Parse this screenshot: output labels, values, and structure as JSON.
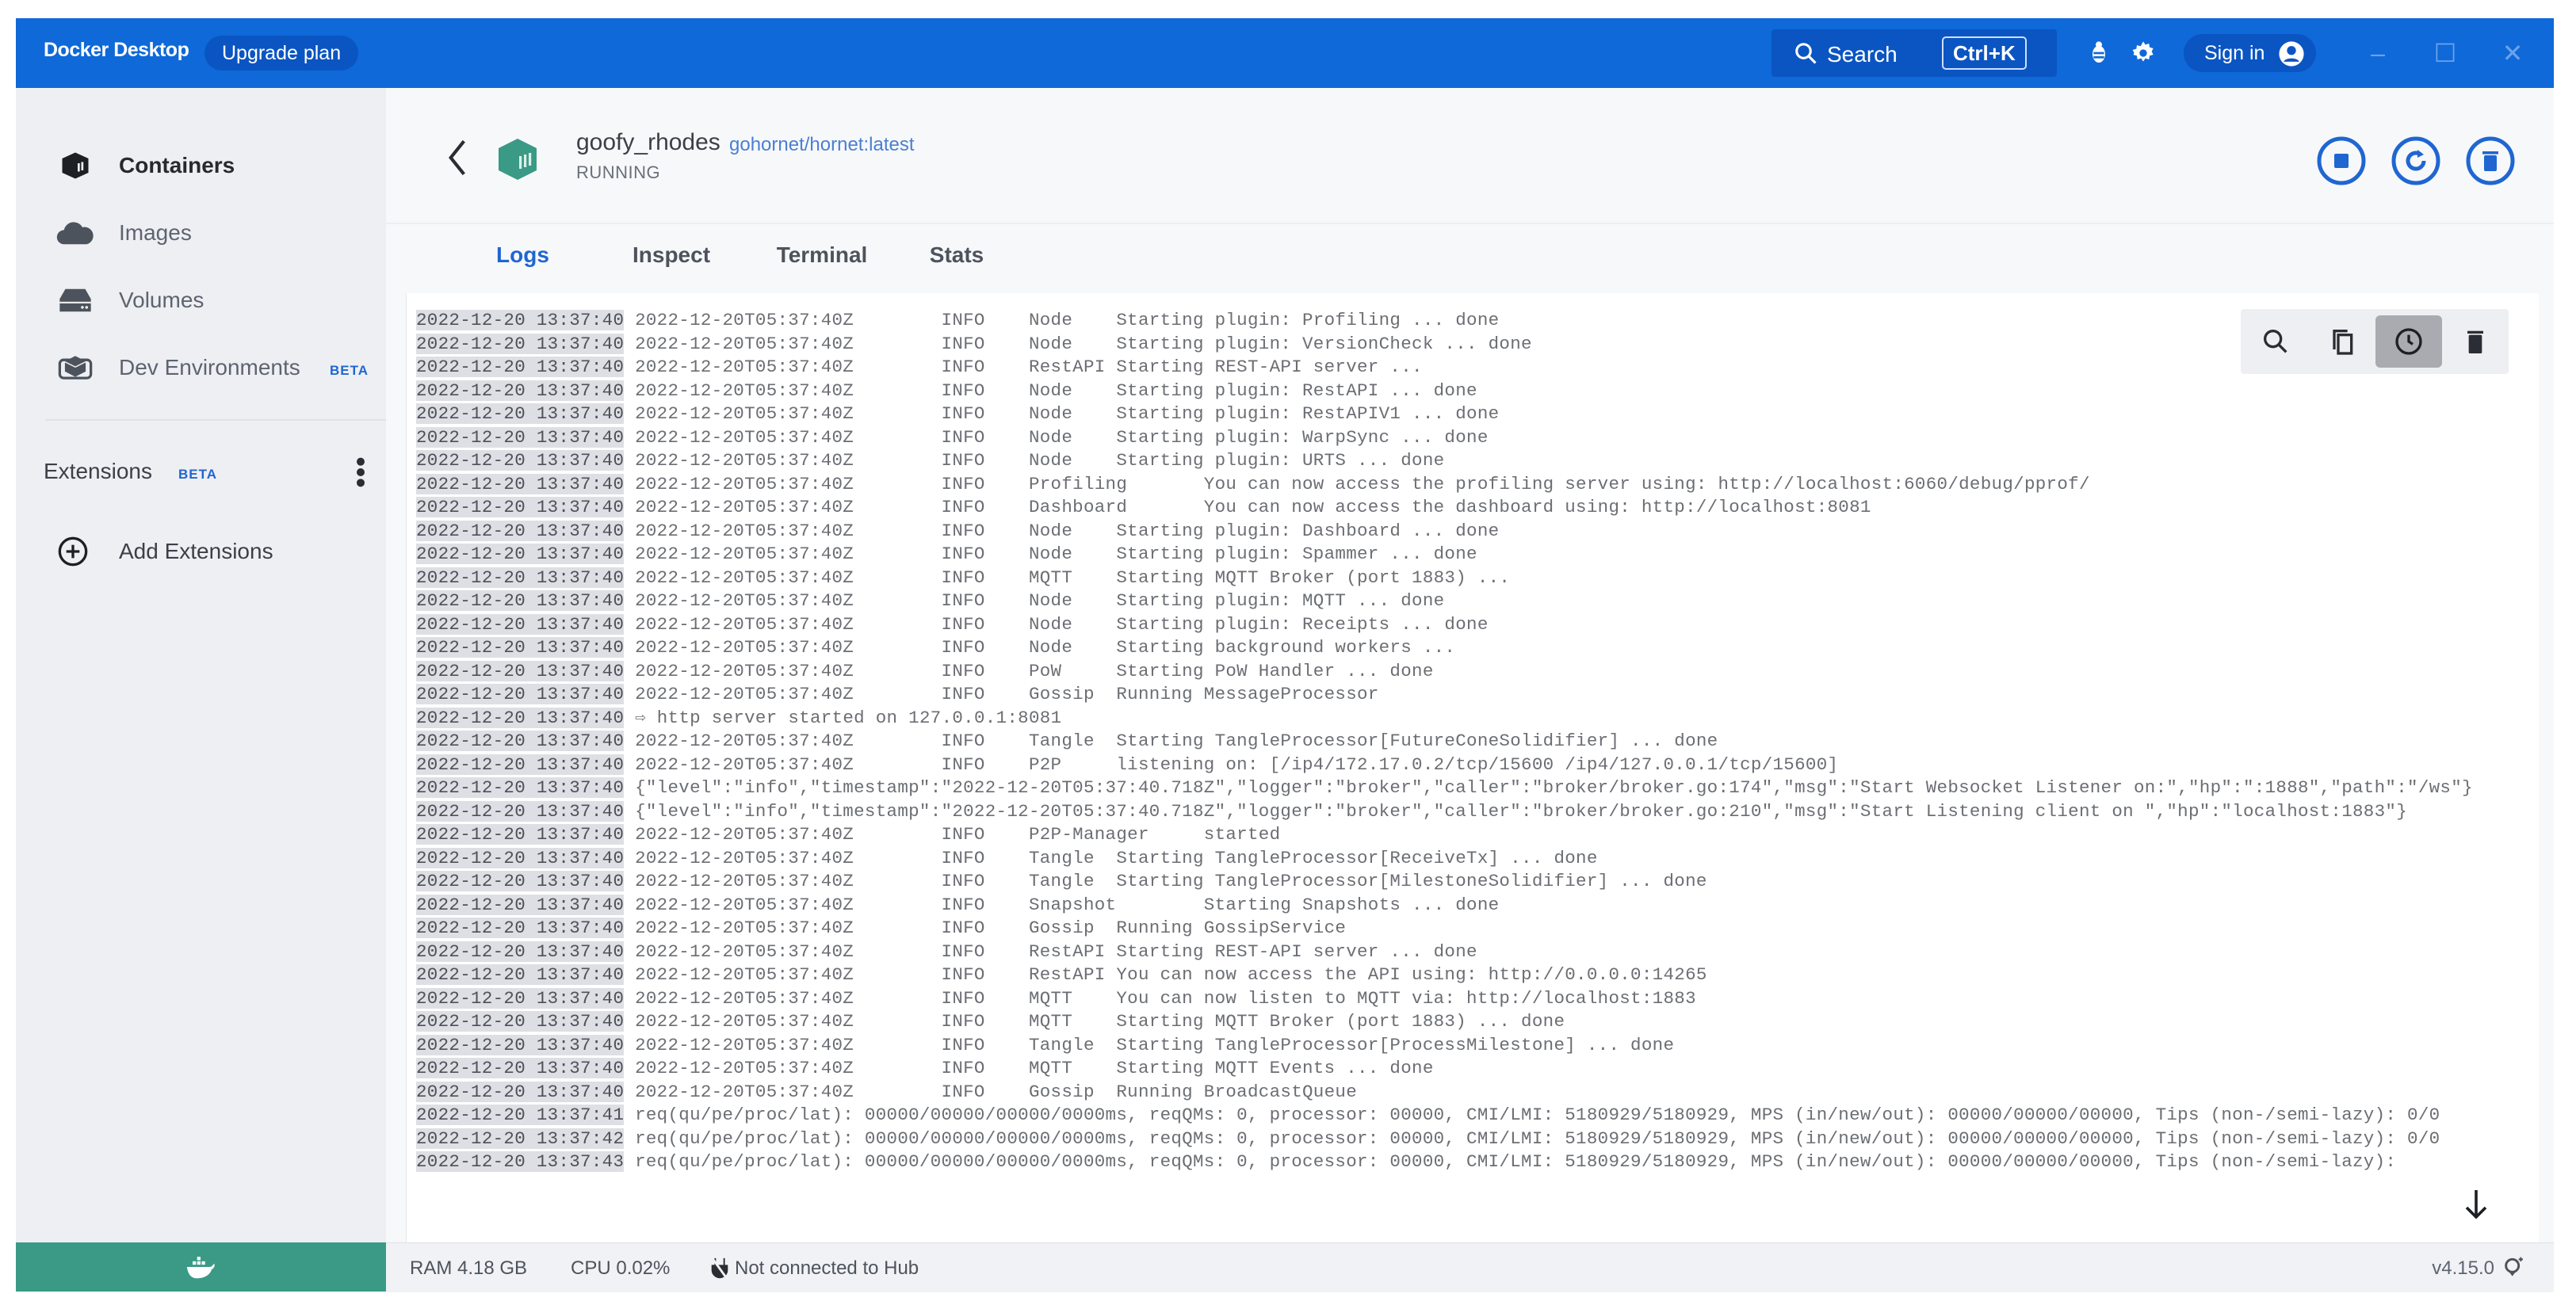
{
  "titlebar": {
    "app_name": "Docker Desktop",
    "upgrade_label": "Upgrade plan",
    "search_label": "Search",
    "search_shortcut": "Ctrl+K",
    "signin_label": "Sign in",
    "minimize": "–",
    "maximize": "☐",
    "close": "✕"
  },
  "sidebar": {
    "items": [
      {
        "label": "Containers",
        "icon": "container-icon",
        "active": true
      },
      {
        "label": "Images",
        "icon": "cloud-icon"
      },
      {
        "label": "Volumes",
        "icon": "volume-icon"
      },
      {
        "label": "Dev Environments",
        "icon": "dev-env-icon",
        "badge": "BETA"
      }
    ],
    "extensions_label": "Extensions",
    "extensions_badge": "BETA",
    "add_extensions_label": "Add Extensions"
  },
  "container": {
    "name": "goofy_rhodes",
    "image": "gohornet/hornet:latest",
    "status": "RUNNING"
  },
  "tabs": [
    {
      "label": "Logs",
      "active": true
    },
    {
      "label": "Inspect"
    },
    {
      "label": "Terminal"
    },
    {
      "label": "Stats"
    }
  ],
  "log_toolbar": [
    "search-icon",
    "copy-icon",
    "timestamps-icon",
    "clear-icon"
  ],
  "logs": [
    {
      "ts": "2022-12-20 13:37:40",
      "text": "2022-12-20T05:37:40Z        INFO    Node    Starting plugin: Profiling ... done"
    },
    {
      "ts": "2022-12-20 13:37:40",
      "text": "2022-12-20T05:37:40Z        INFO    Node    Starting plugin: VersionCheck ... done"
    },
    {
      "ts": "2022-12-20 13:37:40",
      "text": "2022-12-20T05:37:40Z        INFO    RestAPI Starting REST-API server ..."
    },
    {
      "ts": "2022-12-20 13:37:40",
      "text": "2022-12-20T05:37:40Z        INFO    Node    Starting plugin: RestAPI ... done"
    },
    {
      "ts": "2022-12-20 13:37:40",
      "text": "2022-12-20T05:37:40Z        INFO    Node    Starting plugin: RestAPIV1 ... done"
    },
    {
      "ts": "2022-12-20 13:37:40",
      "text": "2022-12-20T05:37:40Z        INFO    Node    Starting plugin: WarpSync ... done"
    },
    {
      "ts": "2022-12-20 13:37:40",
      "text": "2022-12-20T05:37:40Z        INFO    Node    Starting plugin: URTS ... done"
    },
    {
      "ts": "2022-12-20 13:37:40",
      "text": "2022-12-20T05:37:40Z        INFO    Profiling       You can now access the profiling server using: http://localhost:6060/debug/pprof/"
    },
    {
      "ts": "2022-12-20 13:37:40",
      "text": "2022-12-20T05:37:40Z        INFO    Dashboard       You can now access the dashboard using: http://localhost:8081"
    },
    {
      "ts": "2022-12-20 13:37:40",
      "text": "2022-12-20T05:37:40Z        INFO    Node    Starting plugin: Dashboard ... done"
    },
    {
      "ts": "2022-12-20 13:37:40",
      "text": "2022-12-20T05:37:40Z        INFO    Node    Starting plugin: Spammer ... done"
    },
    {
      "ts": "2022-12-20 13:37:40",
      "text": "2022-12-20T05:37:40Z        INFO    MQTT    Starting MQTT Broker (port 1883) ..."
    },
    {
      "ts": "2022-12-20 13:37:40",
      "text": "2022-12-20T05:37:40Z        INFO    Node    Starting plugin: MQTT ... done"
    },
    {
      "ts": "2022-12-20 13:37:40",
      "text": "2022-12-20T05:37:40Z        INFO    Node    Starting plugin: Receipts ... done"
    },
    {
      "ts": "2022-12-20 13:37:40",
      "text": "2022-12-20T05:37:40Z        INFO    Node    Starting background workers ..."
    },
    {
      "ts": "2022-12-20 13:37:40",
      "text": "2022-12-20T05:37:40Z        INFO    PoW     Starting PoW Handler ... done"
    },
    {
      "ts": "2022-12-20 13:37:40",
      "text": "2022-12-20T05:37:40Z        INFO    Gossip  Running MessageProcessor"
    },
    {
      "ts": "2022-12-20 13:37:40",
      "text": "⇨ http server started on 127.0.0.1:8081"
    },
    {
      "ts": "2022-12-20 13:37:40",
      "text": "2022-12-20T05:37:40Z        INFO    Tangle  Starting TangleProcessor[FutureConeSolidifier] ... done"
    },
    {
      "ts": "2022-12-20 13:37:40",
      "text": "2022-12-20T05:37:40Z        INFO    P2P     listening on: [/ip4/172.17.0.2/tcp/15600 /ip4/127.0.0.1/tcp/15600]"
    },
    {
      "ts": "2022-12-20 13:37:40",
      "text": "{\"level\":\"info\",\"timestamp\":\"2022-12-20T05:37:40.718Z\",\"logger\":\"broker\",\"caller\":\"broker/broker.go:174\",\"msg\":\"Start Websocket Listener on:\",\"hp\":\":1888\",\"path\":\"/ws\"}"
    },
    {
      "ts": "2022-12-20 13:37:40",
      "text": "{\"level\":\"info\",\"timestamp\":\"2022-12-20T05:37:40.718Z\",\"logger\":\"broker\",\"caller\":\"broker/broker.go:210\",\"msg\":\"Start Listening client on \",\"hp\":\"localhost:1883\"}"
    },
    {
      "ts": "2022-12-20 13:37:40",
      "text": "2022-12-20T05:37:40Z        INFO    P2P-Manager     started"
    },
    {
      "ts": "2022-12-20 13:37:40",
      "text": "2022-12-20T05:37:40Z        INFO    Tangle  Starting TangleProcessor[ReceiveTx] ... done"
    },
    {
      "ts": "2022-12-20 13:37:40",
      "text": "2022-12-20T05:37:40Z        INFO    Tangle  Starting TangleProcessor[MilestoneSolidifier] ... done"
    },
    {
      "ts": "2022-12-20 13:37:40",
      "text": "2022-12-20T05:37:40Z        INFO    Snapshot        Starting Snapshots ... done"
    },
    {
      "ts": "2022-12-20 13:37:40",
      "text": "2022-12-20T05:37:40Z        INFO    Gossip  Running GossipService"
    },
    {
      "ts": "2022-12-20 13:37:40",
      "text": "2022-12-20T05:37:40Z        INFO    RestAPI Starting REST-API server ... done"
    },
    {
      "ts": "2022-12-20 13:37:40",
      "text": "2022-12-20T05:37:40Z        INFO    RestAPI You can now access the API using: http://0.0.0.0:14265"
    },
    {
      "ts": "2022-12-20 13:37:40",
      "text": "2022-12-20T05:37:40Z        INFO    MQTT    You can now listen to MQTT via: http://localhost:1883"
    },
    {
      "ts": "2022-12-20 13:37:40",
      "text": "2022-12-20T05:37:40Z        INFO    MQTT    Starting MQTT Broker (port 1883) ... done"
    },
    {
      "ts": "2022-12-20 13:37:40",
      "text": "2022-12-20T05:37:40Z        INFO    Tangle  Starting TangleProcessor[ProcessMilestone] ... done"
    },
    {
      "ts": "2022-12-20 13:37:40",
      "text": "2022-12-20T05:37:40Z        INFO    MQTT    Starting MQTT Events ... done"
    },
    {
      "ts": "2022-12-20 13:37:40",
      "text": "2022-12-20T05:37:40Z        INFO    Gossip  Running BroadcastQueue"
    },
    {
      "ts": "2022-12-20 13:37:41",
      "text": "req(qu/pe/proc/lat): 00000/00000/00000/0000ms, reqQMs: 0, processor: 00000, CMI/LMI: 5180929/5180929, MPS (in/new/out): 00000/00000/00000, Tips (non-/semi-lazy): 0/0"
    },
    {
      "ts": "2022-12-20 13:37:42",
      "text": "req(qu/pe/proc/lat): 00000/00000/00000/0000ms, reqQMs: 0, processor: 00000, CMI/LMI: 5180929/5180929, MPS (in/new/out): 00000/00000/00000, Tips (non-/semi-lazy): 0/0"
    },
    {
      "ts": "2022-12-20 13:37:43",
      "text": "req(qu/pe/proc/lat): 00000/00000/00000/0000ms, reqQMs: 0, processor: 00000, CMI/LMI: 5180929/5180929, MPS (in/new/out): 00000/00000/00000, Tips (non-/semi-lazy):"
    }
  ],
  "statusbar": {
    "ram": "RAM 4.18 GB",
    "cpu": "CPU 0.02%",
    "hub_status": "Not connected to Hub",
    "version": "v4.15.0"
  },
  "colors": {
    "brand_blue": "#0f69d8",
    "accent": "#1f66d1",
    "running_green": "#3a9a86"
  }
}
